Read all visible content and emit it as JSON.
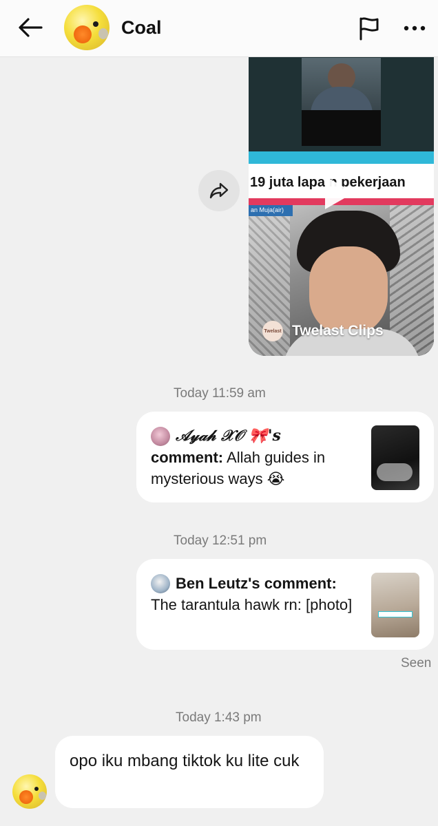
{
  "header": {
    "contact_name": "Coal",
    "back_icon": "arrow-left-icon",
    "report_icon": "flag-icon",
    "more_icon": "more-horizontal-icon"
  },
  "shared_video": {
    "banner_text": "19 juta lapa    n pekerjaan",
    "caption_strip": "an Muja(air)",
    "channel_logo_text": "Twelast",
    "channel_name": "Twelast Clips"
  },
  "messages": {
    "timestamp_1": "Today 11:59 am",
    "comment_1": {
      "author": "𝒜𝓎𝒶𝒽 𝒳𝒪 🎀's",
      "label": "comment:",
      "text": "Allah guides in mysterious ways 😭"
    },
    "timestamp_2": "Today 12:51 pm",
    "comment_2": {
      "author": "Ben Leutz's comment:",
      "text": "The tarantula hawk rn: [photo]"
    },
    "seen": "Seen",
    "timestamp_3": "Today 1:43 pm",
    "incoming_text": "opo iku mbang tiktok ku lite cuk"
  },
  "colors": {
    "background": "#f0f0f0",
    "bubble": "#ffffff",
    "timestamp": "#7a7a7a"
  }
}
